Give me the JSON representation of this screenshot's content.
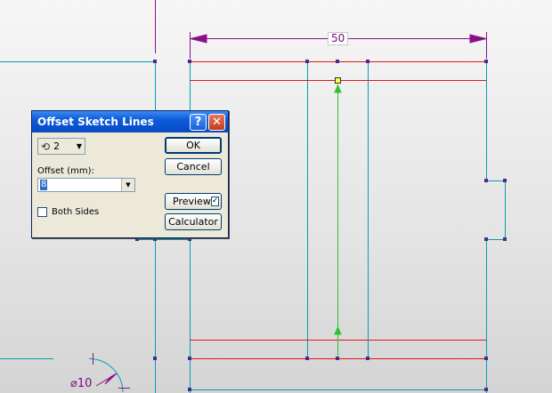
{
  "window": {
    "title": "Offset Sketch Lines"
  },
  "dialog": {
    "count_value": "2",
    "offset_label": "Offset (mm):",
    "offset_value": "8",
    "both_sides_label": "Both Sides",
    "both_sides_checked": false,
    "ok_label": "OK",
    "cancel_label": "Cancel",
    "preview_label": "Preview",
    "preview_checked": true,
    "calculator_label": "Calculator",
    "help_glyph": "?",
    "close_glyph": "✕",
    "check_glyph": "✓"
  },
  "drawing": {
    "dimension_width": "50",
    "dimension_diameter": "⌀10",
    "colors": {
      "sketch_line": "#00a0b4",
      "offset_line": "#e01818",
      "dimension": "#8a108a",
      "constraint": "#30c030"
    }
  },
  "icons": {
    "help": "help-icon",
    "close": "close-icon",
    "count": "offset-count-icon",
    "dropdown": "chevron-down-icon"
  }
}
